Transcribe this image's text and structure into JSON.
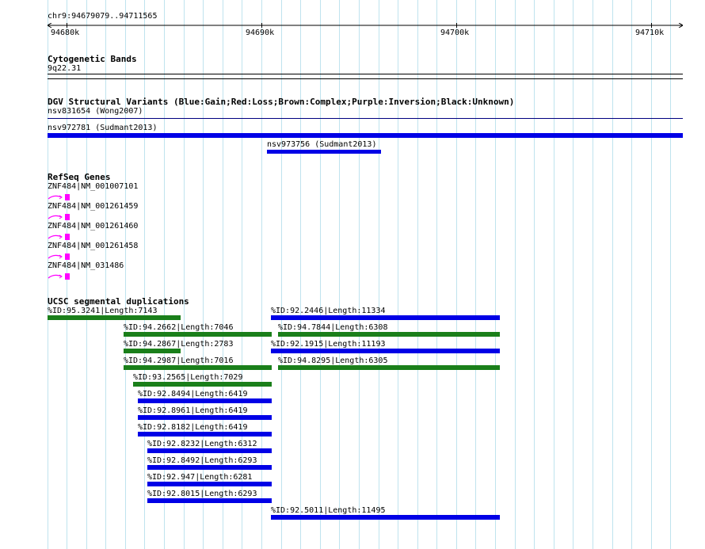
{
  "ruler": {
    "range_label": "chr9:94679079..94711565",
    "start": 94679079,
    "end": 94711565,
    "ticks": [
      "94680k",
      "94690k",
      "94700k",
      "94710k"
    ]
  },
  "cytobands": {
    "title": "Cytogenetic Bands",
    "band": "9q22.31"
  },
  "dgv": {
    "title": "DGV Structural Variants (Blue:Gain;Red:Loss;Brown:Complex;Purple:Inversion;Black:Unknown)",
    "items": [
      {
        "label": "nsv831654 (Wong2007)"
      },
      {
        "label": "nsv972781 (Sudmant2013)"
      },
      {
        "label": "nsv973756 (Sudmant2013)"
      }
    ]
  },
  "refseq": {
    "title": "RefSeq Genes",
    "genes": [
      {
        "label": "ZNF484|NM_001007101"
      },
      {
        "label": "ZNF484|NM_001261459"
      },
      {
        "label": "ZNF484|NM_001261460"
      },
      {
        "label": "ZNF484|NM_001261458"
      },
      {
        "label": "ZNF484|NM_031486"
      }
    ]
  },
  "segdups": {
    "title": "UCSC segmental duplications",
    "items": [
      {
        "label": "%ID:95.3241|Length:7143",
        "color": "green"
      },
      {
        "label": "%ID:92.2446|Length:11334",
        "color": "blue"
      },
      {
        "label": "%ID:94.2662|Length:7046",
        "color": "green"
      },
      {
        "label": "%ID:94.7844|Length:6308",
        "color": "green"
      },
      {
        "label": "%ID:94.2867|Length:2783",
        "color": "green"
      },
      {
        "label": "%ID:92.1915|Length:11193",
        "color": "blue"
      },
      {
        "label": "%ID:94.2987|Length:7016",
        "color": "green"
      },
      {
        "label": "%ID:94.8295|Length:6305",
        "color": "green"
      },
      {
        "label": "%ID:93.2565|Length:7029",
        "color": "green"
      },
      {
        "label": "%ID:92.8494|Length:6419",
        "color": "blue"
      },
      {
        "label": "%ID:92.8961|Length:6419",
        "color": "blue"
      },
      {
        "label": "%ID:92.8182|Length:6419",
        "color": "blue"
      },
      {
        "label": "%ID:92.8232|Length:6312",
        "color": "blue"
      },
      {
        "label": "%ID:92.8492|Length:6293",
        "color": "blue"
      },
      {
        "label": "%ID:92.947|Length:6281",
        "color": "blue"
      },
      {
        "label": "%ID:92.8015|Length:6293",
        "color": "blue"
      },
      {
        "label": "%ID:92.5011|Length:11495",
        "color": "blue"
      }
    ]
  },
  "colors": {
    "gridline": "#bfe3ee",
    "blue": "#0000e6",
    "green": "#1a7f1a",
    "gene": "#ff00ff",
    "dgv_line": "#00007f"
  }
}
